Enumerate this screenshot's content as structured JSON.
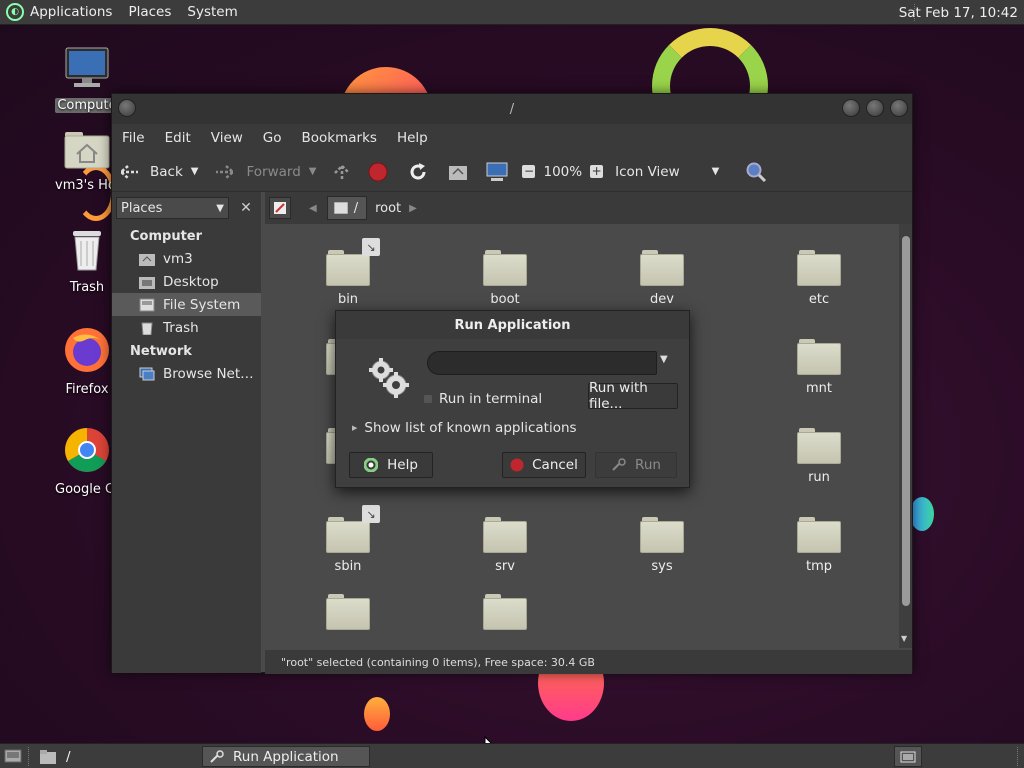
{
  "top_panel": {
    "menus": [
      "Applications",
      "Places",
      "System"
    ],
    "clock": "Sat Feb 17, 10:42"
  },
  "desktop_icons": [
    {
      "label": "Compute",
      "icon": "computer-icon"
    },
    {
      "label": "vm3's Hor",
      "icon": "home-folder-icon"
    },
    {
      "label": "Trash",
      "icon": "trash-icon"
    },
    {
      "label": "Firefox",
      "icon": "firefox-icon"
    },
    {
      "label": "Google Chr",
      "icon": "chrome-icon"
    }
  ],
  "window": {
    "title": "/",
    "menubar": [
      "File",
      "Edit",
      "View",
      "Go",
      "Bookmarks",
      "Help"
    ],
    "toolbar": {
      "back": "Back",
      "forward": "Forward",
      "zoom": "100%",
      "view_mode": "Icon View"
    },
    "sidebar": {
      "combo": "Places",
      "groups": [
        {
          "title": "Computer",
          "items": [
            {
              "label": "vm3",
              "icon": "home-icon"
            },
            {
              "label": "Desktop",
              "icon": "desktop-icon"
            },
            {
              "label": "File System",
              "icon": "drive-icon"
            },
            {
              "label": "Trash",
              "icon": "trash-icon"
            }
          ]
        },
        {
          "title": "Network",
          "items": [
            {
              "label": "Browse Net…",
              "icon": "network-icon"
            }
          ]
        }
      ]
    },
    "location": {
      "segments": [
        "/",
        "root"
      ]
    },
    "files": [
      "bin",
      "boot",
      "dev",
      "etc",
      "mnt",
      "run",
      "sbin",
      "srv",
      "sys",
      "tmp"
    ],
    "status": "\"root\" selected (containing 0 items), Free space: 30.4 GB"
  },
  "dialog": {
    "title": "Run Application",
    "command_value": "",
    "run_in_terminal": "Run in terminal",
    "run_with_file": "Run with file...",
    "show_list": "Show list of known applications",
    "help": "Help",
    "cancel": "Cancel",
    "run": "Run"
  },
  "bottom_panel": {
    "tasks": [
      "/",
      "Run Application"
    ]
  },
  "colors": {
    "panel": "#3c3c3c",
    "window_bg": "#4a4a4a",
    "folder": "#dcdccb",
    "stop_red": "#c0262d"
  }
}
